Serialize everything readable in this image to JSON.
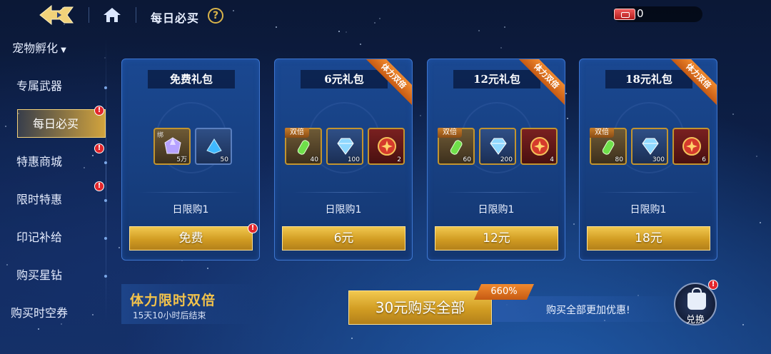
{
  "header": {
    "title": "每日必买",
    "help_icon": "?",
    "currency_value": "0"
  },
  "sidebar": {
    "items": [
      {
        "label": "宠物孵化",
        "caret": "▼",
        "active": false,
        "badge": false
      },
      {
        "label": "专属武器",
        "active": false,
        "badge": false
      },
      {
        "label": "每日必买",
        "active": true,
        "badge": true
      },
      {
        "label": "特惠商城",
        "active": false,
        "badge": true
      },
      {
        "label": "限时特惠",
        "active": false,
        "badge": true
      },
      {
        "label": "印记补给",
        "active": false,
        "badge": false
      },
      {
        "label": "购买星钻",
        "active": false,
        "badge": false
      },
      {
        "label": "购买时空券",
        "active": false,
        "badge": false
      }
    ]
  },
  "cards": [
    {
      "title": "免费礼包",
      "ribbon": "",
      "items": [
        {
          "icon": "purple-crystal-icon",
          "qty": "5万",
          "tag": "绑"
        },
        {
          "icon": "blue-shard-icon",
          "qty": "50",
          "tag": ""
        }
      ],
      "limit": "日限购1",
      "button": "免费",
      "button_badge": true
    },
    {
      "title": "6元礼包",
      "ribbon": "体力双倍",
      "items": [
        {
          "icon": "green-potion-icon",
          "qty": "40",
          "tag": "双倍"
        },
        {
          "icon": "diamond-icon",
          "qty": "100",
          "tag": ""
        },
        {
          "icon": "red-medal-icon",
          "qty": "2",
          "tag": ""
        }
      ],
      "limit": "日限购1",
      "button": "6元",
      "button_badge": false
    },
    {
      "title": "12元礼包",
      "ribbon": "体力双倍",
      "items": [
        {
          "icon": "green-potion-icon",
          "qty": "60",
          "tag": "双倍"
        },
        {
          "icon": "diamond-icon",
          "qty": "200",
          "tag": ""
        },
        {
          "icon": "red-medal-icon",
          "qty": "4",
          "tag": ""
        }
      ],
      "limit": "日限购1",
      "button": "12元",
      "button_badge": false
    },
    {
      "title": "18元礼包",
      "ribbon": "体力双倍",
      "items": [
        {
          "icon": "green-potion-icon",
          "qty": "80",
          "tag": "双倍"
        },
        {
          "icon": "diamond-icon",
          "qty": "300",
          "tag": ""
        },
        {
          "icon": "red-medal-icon",
          "qty": "6",
          "tag": ""
        }
      ],
      "limit": "日限购1",
      "button": "18元",
      "button_badge": false
    }
  ],
  "promo": {
    "title": "体力限时双倍",
    "subtitle": "15天10小时后结束"
  },
  "buy_all": {
    "button": "30元购买全部",
    "discount": "660%",
    "hint": "购买全部更加优惠!"
  },
  "exchange": {
    "label": "兑换"
  },
  "colors": {
    "gold": "#d19c22",
    "accent_orange": "#e07424",
    "badge_red": "#e3262b",
    "card_blue": "#173f80"
  }
}
